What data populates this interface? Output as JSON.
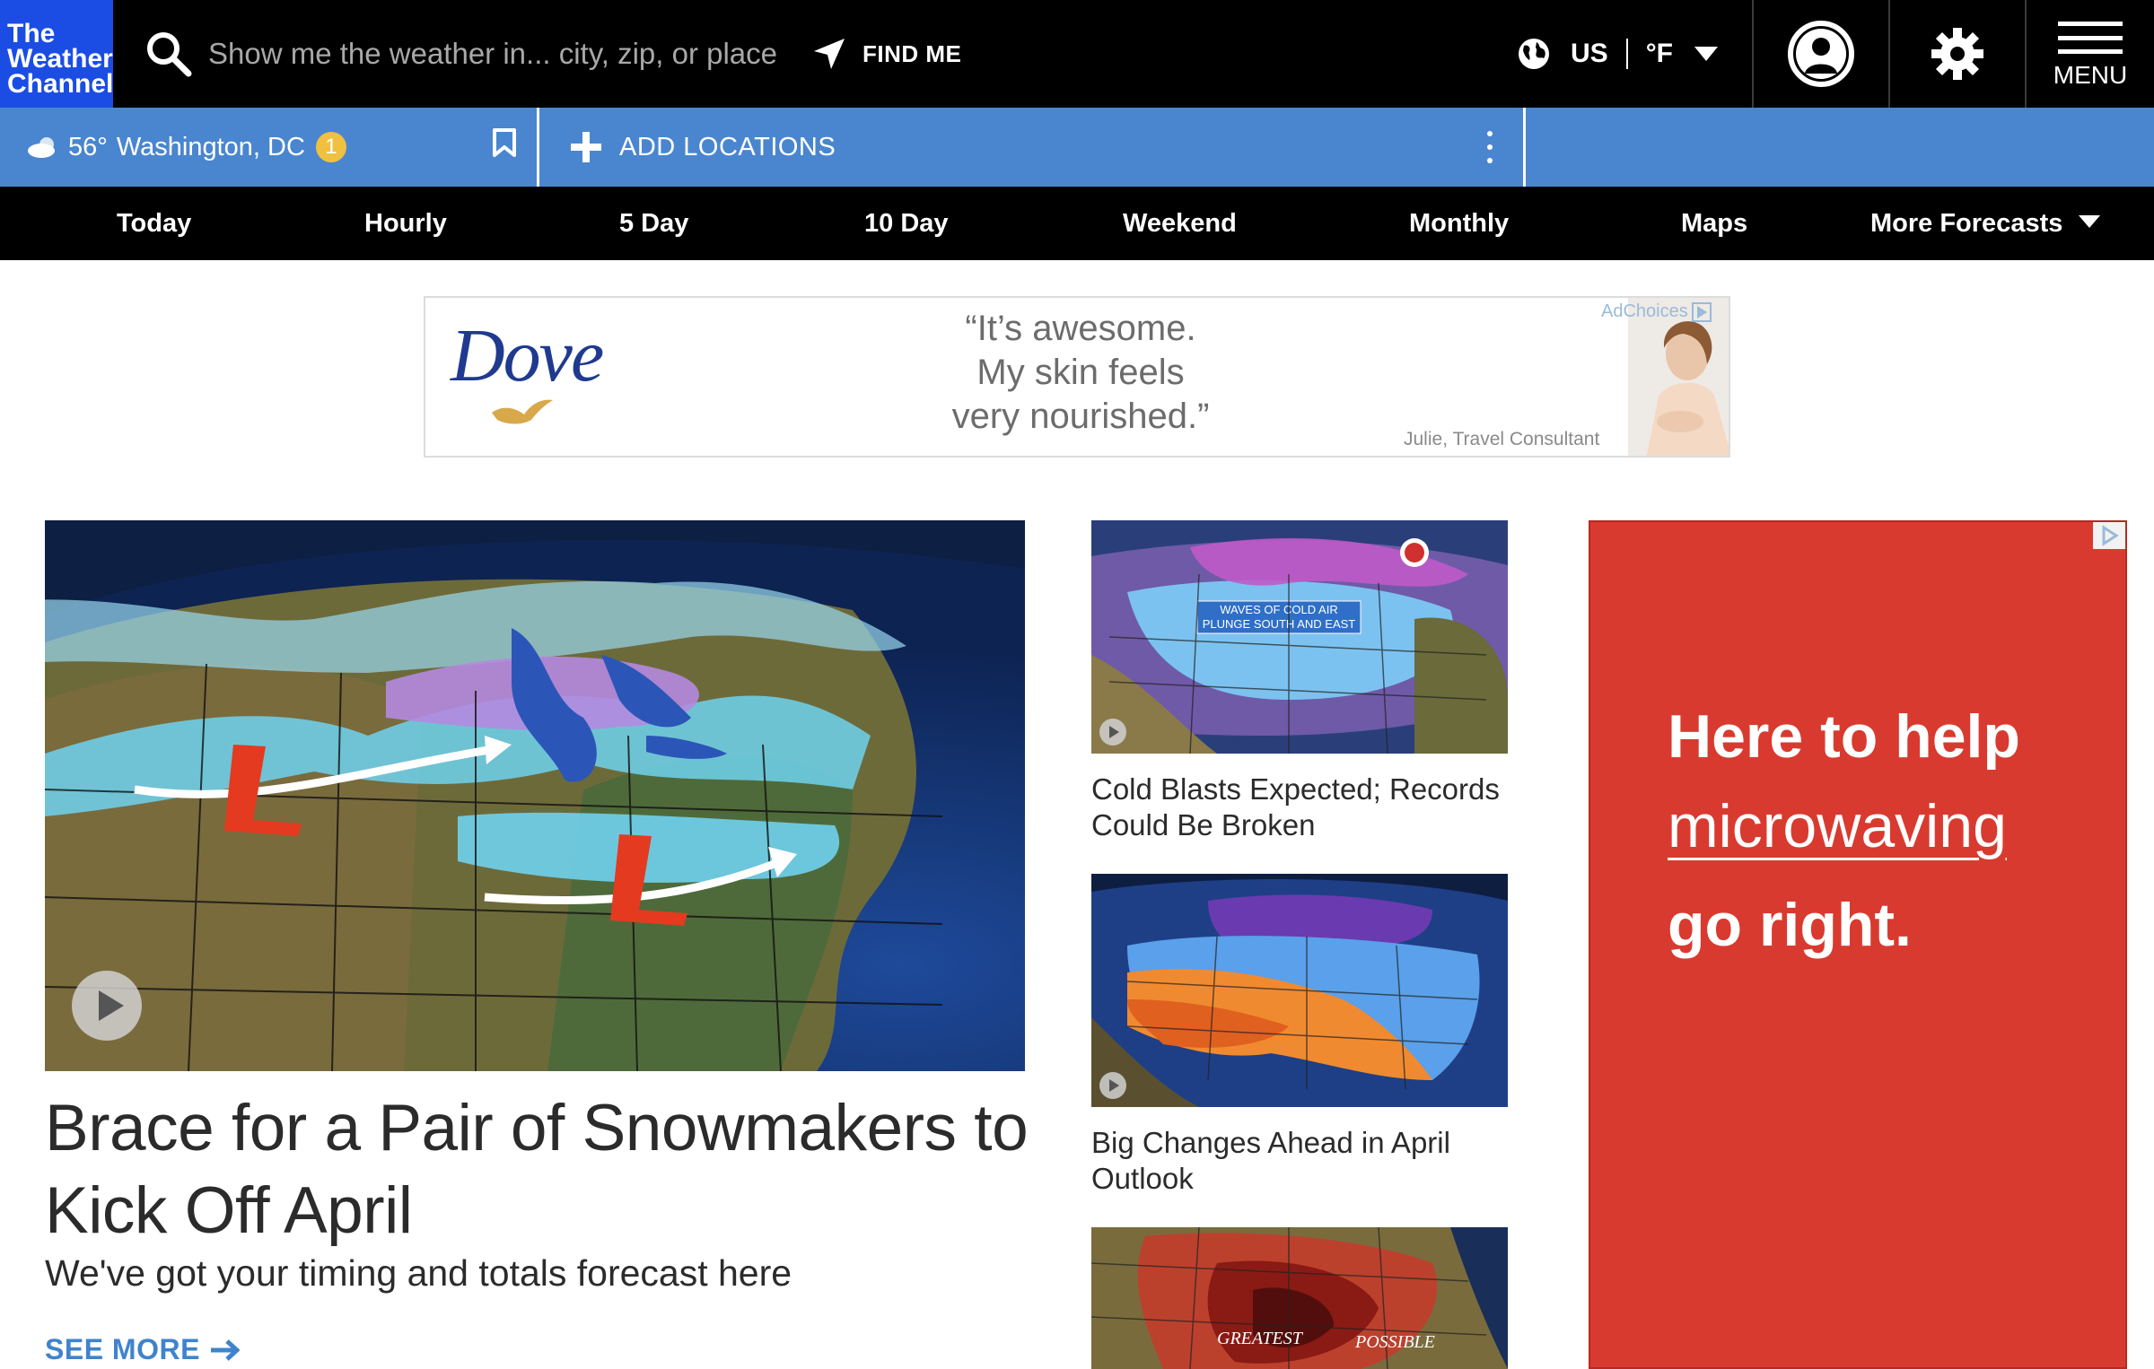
{
  "header": {
    "logo_lines": [
      "The",
      "Weather",
      "Channel"
    ],
    "search_placeholder": "Show me the weather in... city, zip, or place",
    "find_me_label": "FIND ME",
    "region": "US",
    "unit": "°F",
    "menu_label": "MENU"
  },
  "location_bar": {
    "temperature": "56°",
    "city": "Washington, DC",
    "alert_count": "1",
    "add_locations_label": "ADD LOCATIONS"
  },
  "nav": {
    "items": [
      "Today",
      "Hourly",
      "5 Day",
      "10 Day",
      "Weekend",
      "Monthly",
      "Maps",
      "More Forecasts"
    ]
  },
  "top_ad": {
    "brand": "Dove",
    "quote_lines": [
      "“It’s awesome.",
      "My skin feels",
      "very nourished.”"
    ],
    "attribution": "Julie, Travel Consultant",
    "adchoices_label": "AdChoices"
  },
  "hero": {
    "title": "Brace for a Pair of Snowmakers to Kick Off April",
    "subtitle": "We've got your timing and totals forecast here",
    "see_more_label": "SEE MORE"
  },
  "stories": [
    {
      "title": "Cold Blasts Expected; Records Could Be Broken",
      "map_caption": [
        "WAVES OF COLD AIR",
        "PLUNGE SOUTH AND EAST"
      ]
    },
    {
      "title": "Big Changes Ahead in April Outlook"
    },
    {
      "map_caption": [
        "GREATEST",
        "POSSIBLE"
      ]
    }
  ],
  "right_ad": {
    "lines": [
      "Here to help",
      "microwaving",
      "go right."
    ]
  },
  "colors": {
    "logo_blue": "#1b4de4",
    "location_bar_blue": "#4a86cf",
    "link_blue": "#3f83cc",
    "ad_red": "#d93a2f"
  },
  "icons": {
    "search": "search-icon",
    "find_me": "location-arrow-icon",
    "globe": "globe-icon",
    "user": "user-icon",
    "settings": "gear-icon",
    "menu": "hamburger-icon",
    "bookmark": "bookmark-icon",
    "add": "plus-icon",
    "more": "kebab-icon"
  }
}
